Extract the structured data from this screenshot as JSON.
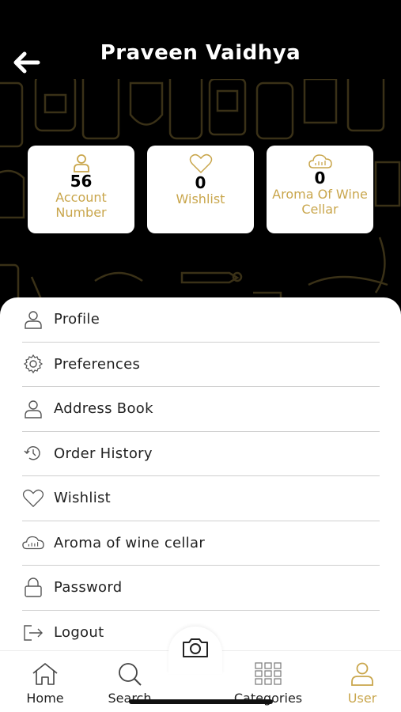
{
  "header": {
    "title": "Praveen Vaidhya",
    "back_icon": "arrow-left-icon"
  },
  "stats": [
    {
      "icon": "user-icon",
      "value": "56",
      "label": "Account Number"
    },
    {
      "icon": "heart-icon",
      "value": "0",
      "label": "Wishlist"
    },
    {
      "icon": "cloud-icon",
      "value": "0",
      "label": "Aroma Of Wine Cellar"
    }
  ],
  "menu": [
    {
      "icon": "user-icon",
      "label": "Profile"
    },
    {
      "icon": "gear-icon",
      "label": "Preferences"
    },
    {
      "icon": "user-icon",
      "label": "Address Book"
    },
    {
      "icon": "history-icon",
      "label": "Order History"
    },
    {
      "icon": "heart-icon",
      "label": "Wishlist"
    },
    {
      "icon": "cloud-icon",
      "label": "Aroma of wine cellar"
    },
    {
      "icon": "lock-icon",
      "label": "Password"
    },
    {
      "icon": "logout-icon",
      "label": "Logout"
    }
  ],
  "tabbar": {
    "home": "Home",
    "search": "Search",
    "categories": "Categories",
    "user": "User",
    "camera_icon": "camera-icon"
  },
  "colors": {
    "accent": "#c9a64c",
    "background": "#000000",
    "sheet": "#ffffff"
  }
}
